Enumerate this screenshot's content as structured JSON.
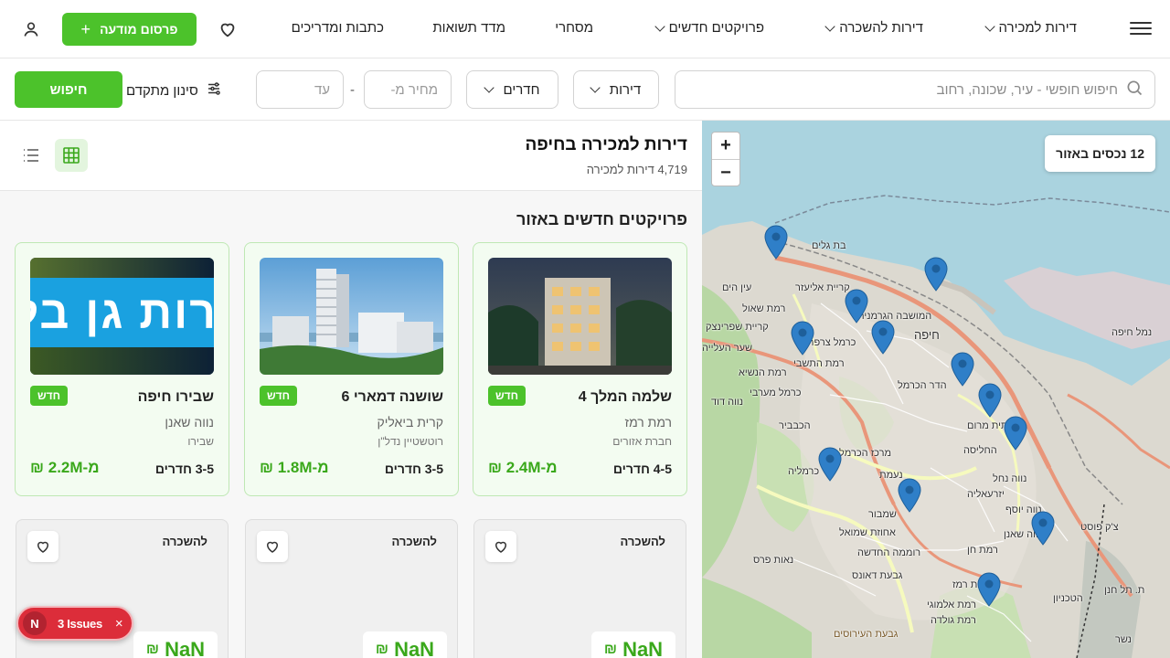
{
  "header": {
    "nav": [
      {
        "label": "דירות למכירה",
        "has_dropdown": true
      },
      {
        "label": "דירות להשכרה",
        "has_dropdown": true
      },
      {
        "label": "פרויקטים חדשים",
        "has_dropdown": true
      },
      {
        "label": "מסחרי",
        "has_dropdown": false
      },
      {
        "label": "מדד תשואות",
        "has_dropdown": false
      },
      {
        "label": "כתבות ומדריכים",
        "has_dropdown": false
      }
    ],
    "post_button": "פרסום מודעה",
    "accent_color": "#4cc22b"
  },
  "search": {
    "placeholder": "חיפוש חופשי - עיר, שכונה, רחוב",
    "property_type": "דירות",
    "rooms": "חדרים",
    "price_from_placeholder": "מחיר מ-",
    "price_to_placeholder": "עד",
    "separator": "-",
    "advanced_filter": "סינון מתקדם",
    "search_button": "חיפוש"
  },
  "list": {
    "title": "דירות למכירה בחיפה",
    "count": "4,719 דירות למכירה",
    "section_title": "פרויקטים חדשים באזור",
    "projects": [
      {
        "name": "שלמה המלך 4",
        "badge": "חדש",
        "neighborhood": "רמת רמז",
        "developer": "חברת אזורים",
        "rooms": "4-5 חדרים",
        "price": "מ-2.4M ₪"
      },
      {
        "name": "שושנה דמארי 6",
        "badge": "חדש",
        "neighborhood": "קרית ביאליק",
        "developer": "רוטשטיין נדל\"ן",
        "rooms": "3-5 חדרים",
        "price": "מ-1.8M ₪"
      },
      {
        "name": "שבירו חיפה",
        "badge": "חדש",
        "neighborhood": "נווה שאנן",
        "developer": "שבירו",
        "rooms": "3-5 חדרים",
        "price": "מ-2.2M ₪",
        "image_text": "דירות גן בלב"
      }
    ],
    "rentals": [
      {
        "tag": "להשכרה",
        "price": "NaN",
        "currency": "₪"
      },
      {
        "tag": "להשכרה",
        "price": "NaN",
        "currency": "₪"
      },
      {
        "tag": "להשכרה",
        "price": "NaN",
        "currency": "₪"
      }
    ]
  },
  "map": {
    "zoom_in": "+",
    "zoom_out": "−",
    "count_badge": "12 נכסים באזור",
    "labels": {
      "bat_galim": "בת גלים",
      "kiryat_eliezer": "קריית אליעזר",
      "ein_hayam": "עין הים",
      "ramat_shaul": "רמת שאול",
      "moshava_germanit": "המושבה הגרמנית",
      "kiryat_sprinzak": "קריית שפרינצק",
      "haifa": "חיפה",
      "karmel_zarfati": "כרמל צרפתי",
      "shaar_haaliya": "שער העלייה",
      "ramat_hatishbi": "רמת התשבי",
      "ramat_hanasi": "רמת הנשיא",
      "hadar_hakarmel": "הדר הכרמל",
      "karmel_maaravi": "כרמל מערבי",
      "neve_david": "נווה דוד",
      "tahtit_merom": "תחתית מרום",
      "hakababir": "הכבביר",
      "halisa": "החליסה",
      "karmelia": "כרמליה",
      "merkaz_hakarmel": "מרכז הכרמל",
      "neamat": "נעמת",
      "neve_nahal": "נווה נחל",
      "yizraeliya": "יזרעאליה",
      "shambur": "שמבור",
      "ahuzat_shmuel": "אחוזת שמואל",
      "neve_yosef": "נווה יוסף",
      "neve_shaanan": "נווה שאנן",
      "naot_peres": "נאות פרס",
      "romema_hahadasha": "רוממה החדשה",
      "ramat_hen": "רמת חן",
      "givat_dauns": "גבעת דאונס",
      "ramat_remez": "רמת רמז",
      "ramat_almogi": "רמת אלמוגי",
      "ramat_golda": "רמת גולדה",
      "tel_hanan": "ת. תל חנן",
      "nemal_haifa": "נמל חיפה",
      "tzak_post": "צ'ק פוסט",
      "nesher": "נשר",
      "technion": "הטכניון",
      "givat_haiirusim": "גבעת העירוסים"
    },
    "colors": {
      "sea": "#aad3df",
      "land": "#dcd9d0",
      "park": "#b8d7a4",
      "road_primary": "#e9967a",
      "road_secondary": "#f6fabe",
      "pin": "#2f7fc8"
    }
  },
  "issues": {
    "initial": "N",
    "label": "3 Issues",
    "close": "×",
    "color": "#dc2d3a"
  }
}
